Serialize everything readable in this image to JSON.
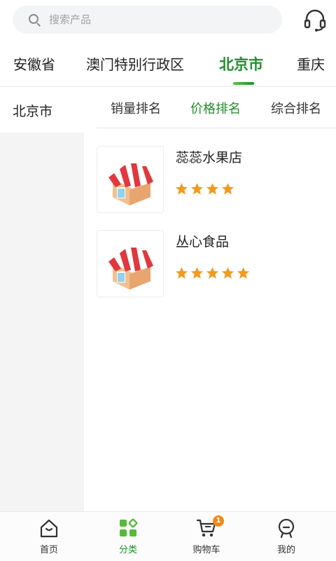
{
  "search": {
    "placeholder": "搜索产品"
  },
  "province_tabs": [
    {
      "label": "安徽省"
    },
    {
      "label": "澳门特别行政区"
    },
    {
      "label": "北京市",
      "active": true
    },
    {
      "label": "重庆"
    }
  ],
  "cities": [
    {
      "label": "北京市",
      "active": true
    }
  ],
  "sort_tabs": [
    {
      "label": "销量排名"
    },
    {
      "label": "价格排名",
      "active": true
    },
    {
      "label": "综合排名"
    }
  ],
  "shops": [
    {
      "name": "蕊蕊水果店",
      "rating": 4
    },
    {
      "name": "丛心食品",
      "rating": 5
    }
  ],
  "bottom_nav": [
    {
      "label": "首页",
      "icon": "home-icon"
    },
    {
      "label": "分类",
      "icon": "category-icon",
      "active": true
    },
    {
      "label": "购物车",
      "icon": "cart-icon",
      "badge": "1"
    },
    {
      "label": "我的",
      "icon": "profile-icon"
    }
  ],
  "colors": {
    "accent": "#1f8f2a",
    "star": "#f39a1e",
    "badge": "#f08a1c"
  }
}
